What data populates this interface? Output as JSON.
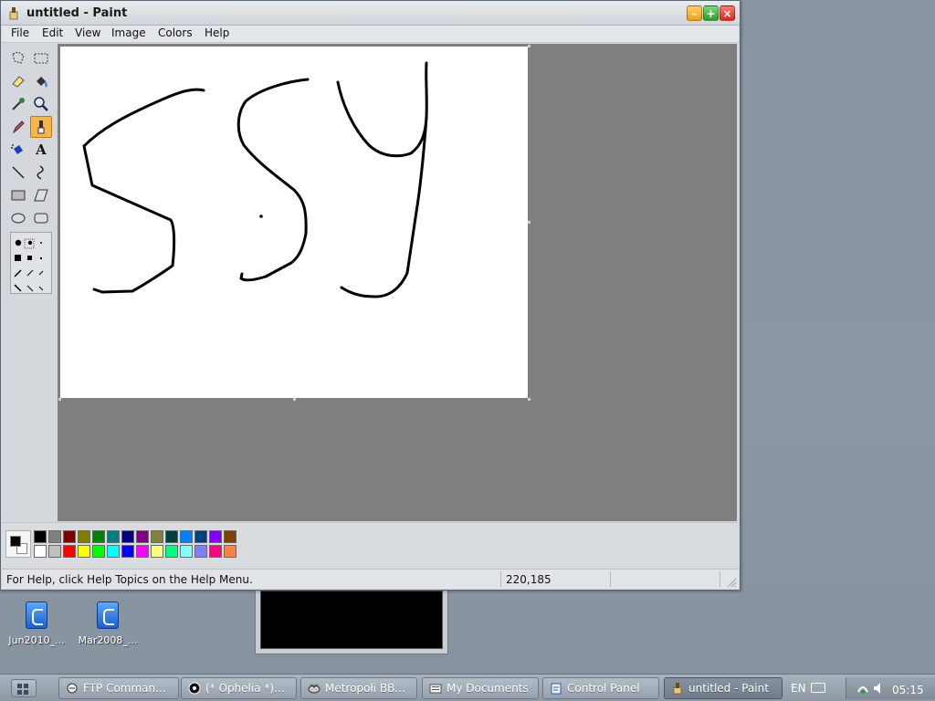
{
  "window": {
    "title": "untitled - Paint",
    "minimize_symbol": "–",
    "maximize_symbol": "+",
    "close_symbol": "×"
  },
  "menu": [
    "File",
    "Edit",
    "View",
    "Image",
    "Colors",
    "Help"
  ],
  "tools": [
    {
      "name": "free-form-select",
      "selected": false
    },
    {
      "name": "select",
      "selected": false
    },
    {
      "name": "eraser",
      "selected": false
    },
    {
      "name": "fill-with-color",
      "selected": false
    },
    {
      "name": "pick-color",
      "selected": false
    },
    {
      "name": "magnifier",
      "selected": false
    },
    {
      "name": "pencil",
      "selected": false
    },
    {
      "name": "brush",
      "selected": true
    },
    {
      "name": "airbrush",
      "selected": false
    },
    {
      "name": "text",
      "selected": false
    },
    {
      "name": "line",
      "selected": false
    },
    {
      "name": "curve",
      "selected": false
    },
    {
      "name": "rectangle",
      "selected": false
    },
    {
      "name": "polygon",
      "selected": false
    },
    {
      "name": "ellipse",
      "selected": false
    },
    {
      "name": "rounded-rectangle",
      "selected": false
    }
  ],
  "text_tool_glyph": "A",
  "palette": {
    "foreground": "#000000",
    "background": "#ffffff",
    "row1": [
      "#000000",
      "#808080",
      "#800000",
      "#808000",
      "#008000",
      "#008080",
      "#000080",
      "#800080",
      "#808040",
      "#004040",
      "#0080ff",
      "#004080",
      "#8000ff",
      "#804000"
    ],
    "row2": [
      "#ffffff",
      "#c0c0c0",
      "#ff0000",
      "#ffff00",
      "#00ff00",
      "#00ffff",
      "#0000ff",
      "#ff00ff",
      "#ffff80",
      "#00ff80",
      "#80ffff",
      "#8080ff",
      "#ff0080",
      "#ff8040"
    ]
  },
  "status": {
    "help_text": "For Help, click Help Topics on the Help Menu.",
    "coords": "220,185"
  },
  "desktop_icons": [
    {
      "label": "Jun2010_..."
    },
    {
      "label": "Mar2008_..."
    }
  ],
  "taskbar": {
    "tasks": [
      {
        "label": "FTP Comman...",
        "icon": "ftp-icon",
        "active": false
      },
      {
        "label": "(* Ophelia *)...",
        "icon": "media-icon",
        "active": false
      },
      {
        "label": "Metropoli BB...",
        "icon": "telnet-icon",
        "active": false
      },
      {
        "label": "My Documents",
        "icon": "folder-icon",
        "active": false
      },
      {
        "label": "Control Panel",
        "icon": "control-panel-icon",
        "active": false
      },
      {
        "label": "untitled - Paint",
        "icon": "paint-icon",
        "active": true
      }
    ],
    "language": "EN",
    "clock": "05:15"
  }
}
